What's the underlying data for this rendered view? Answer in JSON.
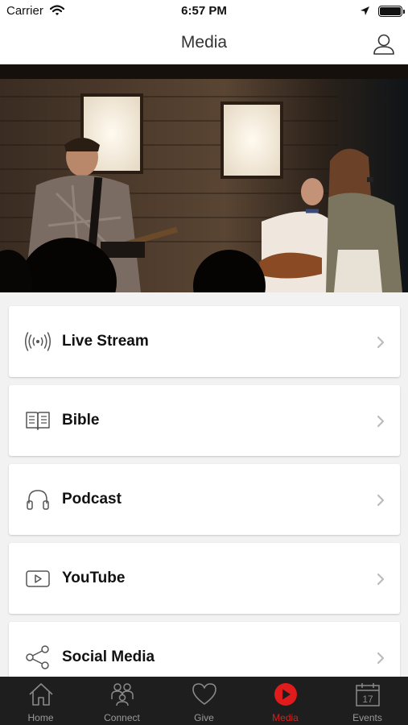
{
  "status_bar": {
    "carrier": "Carrier",
    "time": "6:57 PM"
  },
  "header": {
    "title": "Media"
  },
  "menu": {
    "items": [
      {
        "label": "Live Stream",
        "icon": "broadcast-icon"
      },
      {
        "label": "Bible",
        "icon": "book-icon"
      },
      {
        "label": "Podcast",
        "icon": "headphones-icon"
      },
      {
        "label": "YouTube",
        "icon": "play-icon"
      },
      {
        "label": "Social Media",
        "icon": "share-icon"
      }
    ]
  },
  "tab_bar": {
    "active": "Media",
    "active_color": "#e01b1b",
    "tabs": [
      {
        "label": "Home",
        "icon": "home-icon"
      },
      {
        "label": "Connect",
        "icon": "people-icon"
      },
      {
        "label": "Give",
        "icon": "heart-icon"
      },
      {
        "label": "Media",
        "icon": "play-circle-icon"
      },
      {
        "label": "Events",
        "icon": "calendar-icon",
        "date": "17"
      }
    ]
  }
}
